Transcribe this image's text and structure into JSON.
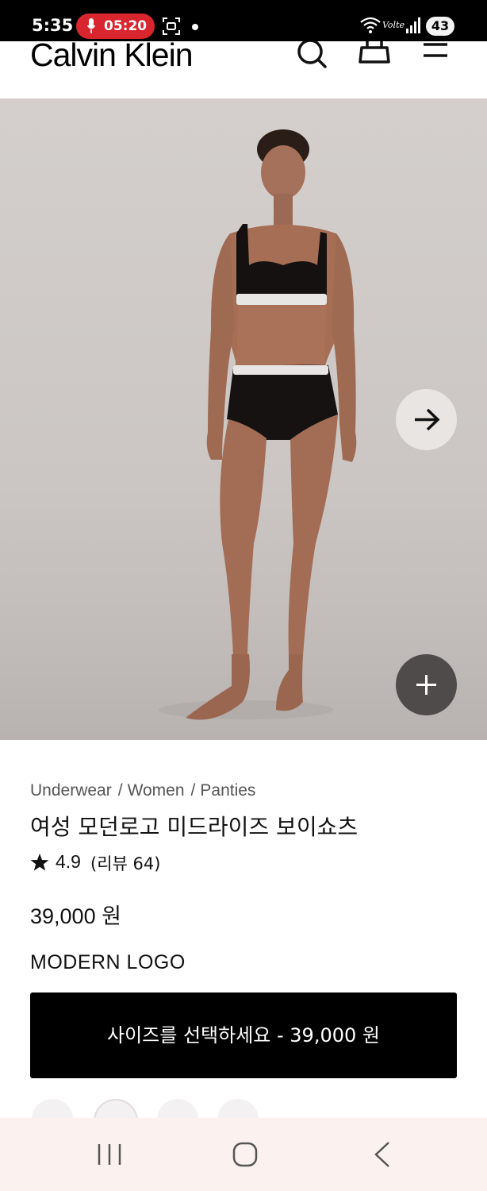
{
  "status_bar": {
    "time": "5:35",
    "recording_time": "05:20",
    "network_label": "Volte",
    "battery": "43"
  },
  "header": {
    "logo": "Calvin Klein",
    "icons": [
      "search-icon",
      "shopping-bag-icon",
      "menu-icon"
    ]
  },
  "hero": {
    "next_icon": "arrow-right-icon",
    "zoom_icon": "plus-icon"
  },
  "product": {
    "breadcrumb": [
      "Underwear",
      "Women",
      "Panties"
    ],
    "breadcrumb_separator": "/",
    "title": "여성 모던로고 미드라이즈 보이쇼츠",
    "rating": "4.9",
    "review_count": "(리뷰 64)",
    "price": "39,000 원",
    "collection": "MODERN LOGO",
    "cta_label": "사이즈를 선택하세요 - 39,000 원"
  },
  "colors": {
    "cta_background": "#000000",
    "status_bar": "#000000",
    "recording_pill": "#d9262e",
    "nav_bar": "#fbf1ef"
  },
  "nav_bar": {
    "icons": [
      "recent-apps-icon",
      "home-icon",
      "back-icon"
    ]
  }
}
